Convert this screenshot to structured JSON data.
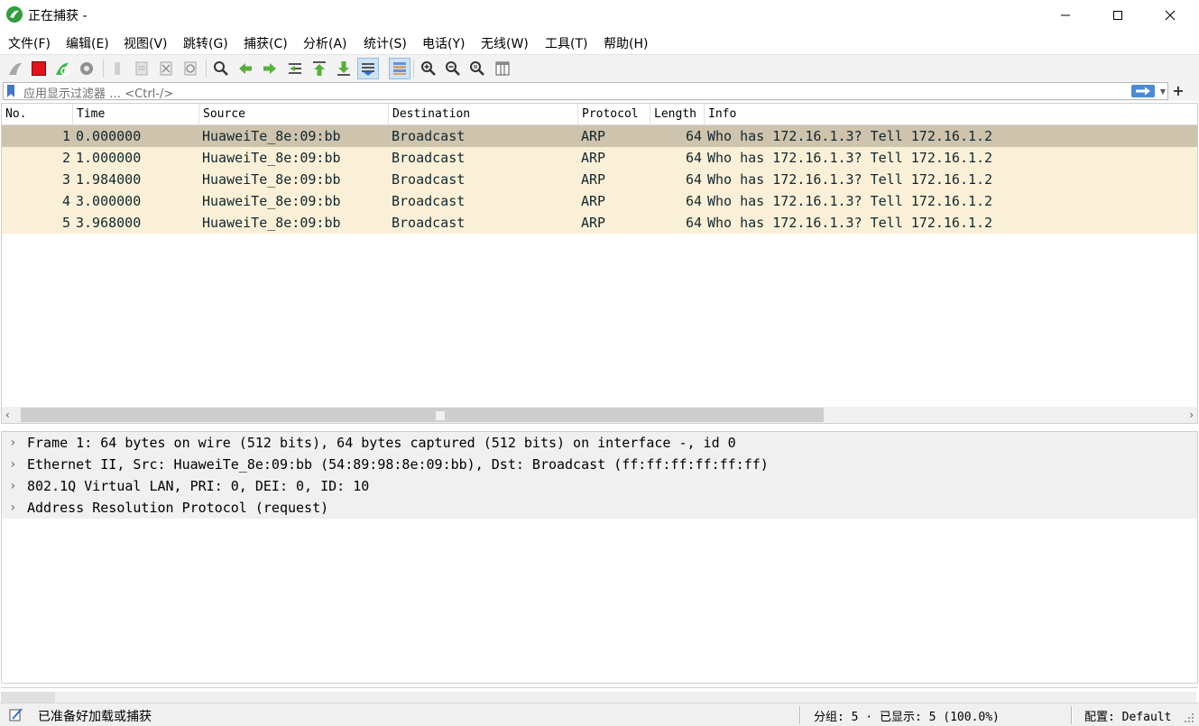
{
  "window": {
    "title": "正在捕获 -"
  },
  "menu": [
    {
      "label": "文件(F)"
    },
    {
      "label": "编辑(E)"
    },
    {
      "label": "视图(V)"
    },
    {
      "label": "跳转(G)"
    },
    {
      "label": "捕获(C)"
    },
    {
      "label": "分析(A)"
    },
    {
      "label": "统计(S)"
    },
    {
      "label": "电话(Y)"
    },
    {
      "label": "无线(W)"
    },
    {
      "label": "工具(T)"
    },
    {
      "label": "帮助(H)"
    }
  ],
  "toolbar": {
    "icons": [
      "shark-fin-start-icon",
      "stop-capture-icon",
      "restart-capture-icon",
      "capture-options-icon",
      "open-file-icon",
      "save-file-icon",
      "close-file-icon",
      "reload-file-icon",
      "find-packet-icon",
      "go-back-icon",
      "go-forward-icon",
      "go-to-packet-icon",
      "go-first-icon",
      "go-last-icon",
      "autoscroll-icon",
      "colorize-icon",
      "zoom-in-icon",
      "zoom-out-icon",
      "zoom-normal-icon",
      "resize-columns-icon"
    ],
    "colors": {
      "stop": "#e0141e",
      "restart": "#3fb54b",
      "arrow": "#57b03a"
    }
  },
  "filter": {
    "placeholder": "应用显示过滤器 … <Ctrl-/>",
    "add_label": "+"
  },
  "packet_list": {
    "columns": [
      "No.",
      "Time",
      "Source",
      "Destination",
      "Protocol",
      "Length",
      "Info"
    ],
    "rows": [
      {
        "no": "1",
        "time": "0.000000",
        "source": "HuaweiTe_8e:09:bb",
        "destination": "Broadcast",
        "protocol": "ARP",
        "length": "64",
        "info": "Who has 172.16.1.3? Tell 172.16.1.2"
      },
      {
        "no": "2",
        "time": "1.000000",
        "source": "HuaweiTe_8e:09:bb",
        "destination": "Broadcast",
        "protocol": "ARP",
        "length": "64",
        "info": "Who has 172.16.1.3? Tell 172.16.1.2"
      },
      {
        "no": "3",
        "time": "1.984000",
        "source": "HuaweiTe_8e:09:bb",
        "destination": "Broadcast",
        "protocol": "ARP",
        "length": "64",
        "info": "Who has 172.16.1.3? Tell 172.16.1.2"
      },
      {
        "no": "4",
        "time": "3.000000",
        "source": "HuaweiTe_8e:09:bb",
        "destination": "Broadcast",
        "protocol": "ARP",
        "length": "64",
        "info": "Who has 172.16.1.3? Tell 172.16.1.2"
      },
      {
        "no": "5",
        "time": "3.968000",
        "source": "HuaweiTe_8e:09:bb",
        "destination": "Broadcast",
        "protocol": "ARP",
        "length": "64",
        "info": "Who has 172.16.1.3? Tell 172.16.1.2"
      }
    ],
    "row_color": "#faf0d7",
    "selected_color": "#cec3ad"
  },
  "details": [
    {
      "text": "Frame 1: 64 bytes on wire (512 bits), 64 bytes captured (512 bits) on interface -, id 0"
    },
    {
      "text": "Ethernet II, Src: HuaweiTe_8e:09:bb (54:89:98:8e:09:bb), Dst: Broadcast (ff:ff:ff:ff:ff:ff)"
    },
    {
      "text": "802.1Q Virtual LAN, PRI: 0, DEI: 0, ID: 10"
    },
    {
      "text": "Address Resolution Protocol (request)"
    }
  ],
  "status": {
    "ready": "已准备好加载或捕获",
    "packets": "分组: 5 · 已显示: 5 (100.0%)",
    "profile": "配置: Default"
  }
}
